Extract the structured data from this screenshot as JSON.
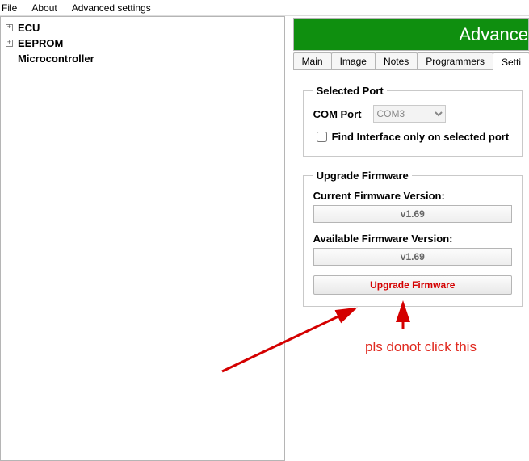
{
  "menu": {
    "file": "File",
    "about": "About",
    "advanced": "Advanced settings"
  },
  "tree": {
    "ecu": "ECU",
    "eeprom": "EEPROM",
    "micro": "Microcontroller"
  },
  "banner": "Advance",
  "tabs": {
    "main": "Main",
    "image": "Image",
    "notes": "Notes",
    "programmers": "Programmers",
    "settings": "Setti"
  },
  "port": {
    "legend": "Selected Port",
    "label": "COM Port",
    "value": "COM3",
    "checkbox_label": "Find Interface only on selected port"
  },
  "firmware": {
    "legend": "Upgrade Firmware",
    "current_label": "Current Firmware Version:",
    "current_value": "v1.69",
    "available_label": "Available Firmware Version:",
    "available_value": "v1.69",
    "button": "Upgrade Firmware"
  },
  "annotation": {
    "text": "pls donot click this"
  }
}
